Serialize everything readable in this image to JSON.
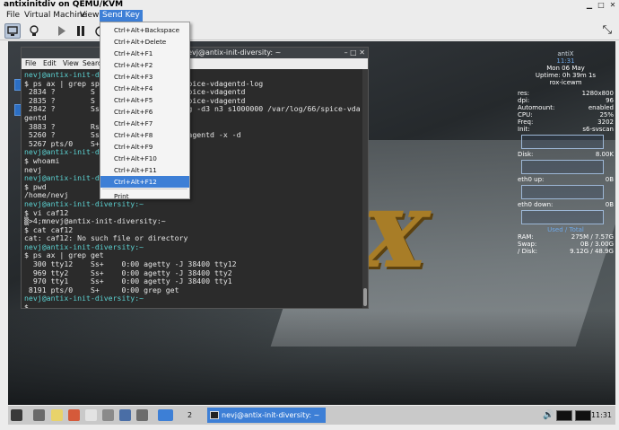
{
  "window": {
    "title": "antixinitdiv on QEMU/KVM"
  },
  "menubar": [
    "File",
    "Virtual Machine",
    "View",
    "Send Key"
  ],
  "send_key_menu": [
    "Ctrl+Alt+Backspace",
    "Ctrl+Alt+Delete",
    "Ctrl+Alt+F1",
    "Ctrl+Alt+F2",
    "Ctrl+Alt+F3",
    "Ctrl+Alt+F4",
    "Ctrl+Alt+F5",
    "Ctrl+Alt+F6",
    "Ctrl+Alt+F7",
    "Ctrl+Alt+F8",
    "Ctrl+Alt+F9",
    "Ctrl+Alt+F10",
    "Ctrl+Alt+F11",
    "Ctrl+Alt+F12",
    "Print"
  ],
  "send_key_selected_index": 13,
  "terminal": {
    "title": "nevj@antix-init-diversity: ~",
    "menu": [
      "File",
      "Edit",
      "View",
      "Search"
    ],
    "lines": [
      {
        "u": "nevj@antix-init-di",
        "t": ""
      },
      {
        "u": "",
        "t": "$ ps ax | grep sp                   spice-vdagentd-log"
      },
      {
        "u": "",
        "t": " 2834 ?        S                    spice-vdagentd"
      },
      {
        "u": "",
        "t": " 2835 ?        S                    spice-vdagentd"
      },
      {
        "u": "",
        "t": " 2842 ?        Ss                  log -d3 n3 s1000000 /var/log/66/spice-vda"
      },
      {
        "u": "",
        "t": "gentd"
      },
      {
        "u": "",
        "t": " 3883 ?        Rs                  t"
      },
      {
        "u": "",
        "t": " 5260 ?        Ss                  vdagentd -x -d"
      },
      {
        "u": "",
        "t": " 5267 pts/0    S+"
      },
      {
        "u": "nevj@antix-init-di",
        "t": ""
      },
      {
        "u": "",
        "t": "$ whoami"
      },
      {
        "u": "",
        "t": "nevj"
      },
      {
        "u": "nevj@antix-init-di",
        "t": ""
      },
      {
        "u": "",
        "t": "$ pwd"
      },
      {
        "u": "",
        "t": "/home/nevj"
      },
      {
        "u": "nevj@antix-init-diversity:~",
        "t": ""
      },
      {
        "u": "",
        "t": "$ vi caf12"
      },
      {
        "u": "",
        "t": "▒>4;mnevj@antix-init-diversity:~"
      },
      {
        "u": "",
        "t": "$ cat caf12"
      },
      {
        "u": "",
        "t": "cat: caf12: No such file or directory"
      },
      {
        "u": "nevj@antix-init-diversity:~",
        "t": ""
      },
      {
        "u": "",
        "t": "$ ps ax | grep get"
      },
      {
        "u": "",
        "t": "  300 tty12    Ss+    0:00 agetty -J 38400 tty12"
      },
      {
        "u": "",
        "t": "  969 tty2     Ss+    0:00 agetty -J 38400 tty2"
      },
      {
        "u": "",
        "t": "  970 tty1     Ss+    0:00 agetty -J 38400 tty1"
      },
      {
        "u": "",
        "t": " 8191 pts/0    S+     0:00 grep get"
      },
      {
        "u": "nevj@antix-init-diversity:~",
        "t": ""
      },
      {
        "u": "",
        "t": "$"
      }
    ]
  },
  "conky": {
    "distro": "antiX",
    "time": "11:31",
    "date": "Mon 06 May",
    "uptime": "Uptime: 0h 39m 1s",
    "wm": "rox-icewm",
    "stats": [
      {
        "k": "res:",
        "v": "1280x800"
      },
      {
        "k": "dpi:",
        "v": "96"
      },
      {
        "k": "Automount:",
        "v": "enabled"
      },
      {
        "k": "CPU:",
        "v": "25%"
      },
      {
        "k": "Freq:",
        "v": "3202"
      },
      {
        "k": "Init:",
        "v": "s6-svscan"
      }
    ],
    "disk": {
      "k": "Disk:",
      "v": "8.00K"
    },
    "eth_up": {
      "k": "eth0 up:",
      "v": "0B"
    },
    "eth_down": {
      "k": "eth0 down:",
      "v": "0B"
    },
    "mem_header": "Used / Total",
    "mem": [
      {
        "k": "RAM:",
        "v": "275M / 7.57G"
      },
      {
        "k": "Swap:",
        "v": "0B / 3.00G"
      },
      {
        "k": "/ Disk:",
        "v": "9.12G / 48.9G"
      }
    ]
  },
  "taskbar": {
    "workspace": "2",
    "task": "nevj@antix-init-diversity: ~",
    "clock": "11:31"
  }
}
